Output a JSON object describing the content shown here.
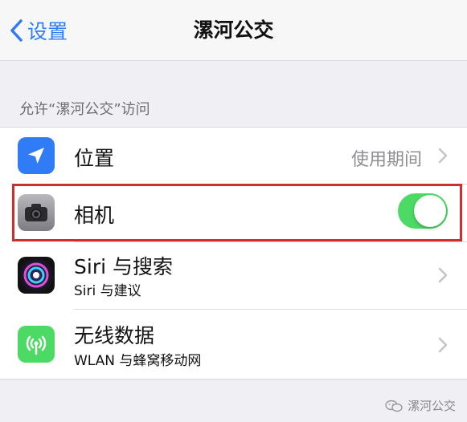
{
  "nav": {
    "back_label": "设置",
    "title": "漯河公交"
  },
  "section": {
    "header": "允许“漯河公交”访问"
  },
  "rows": [
    {
      "icon": "location-arrow-icon",
      "icon_bg": "#2f7cf6",
      "title": "位置",
      "value": "使用期间",
      "accessory": "chevron"
    },
    {
      "icon": "camera-icon",
      "icon_bg": "#8e8e93",
      "title": "相机",
      "toggle_on": true,
      "accessory": "toggle"
    },
    {
      "icon": "siri-icon",
      "icon_bg": "#1b1b3a",
      "title": "Siri 与搜索",
      "subtitle": "Siri 与建议",
      "accessory": "chevron"
    },
    {
      "icon": "antenna-icon",
      "icon_bg": "#4cd964",
      "title": "无线数据",
      "subtitle": "WLAN 与蜂窝移动网",
      "accessory": "chevron"
    }
  ],
  "colors": {
    "accent": "#2f7cf6",
    "toggle_on": "#4cd964",
    "highlight_border": "#cf2f2a"
  },
  "watermark": {
    "text": "漯河公交",
    "icon": "wechat-icon"
  }
}
